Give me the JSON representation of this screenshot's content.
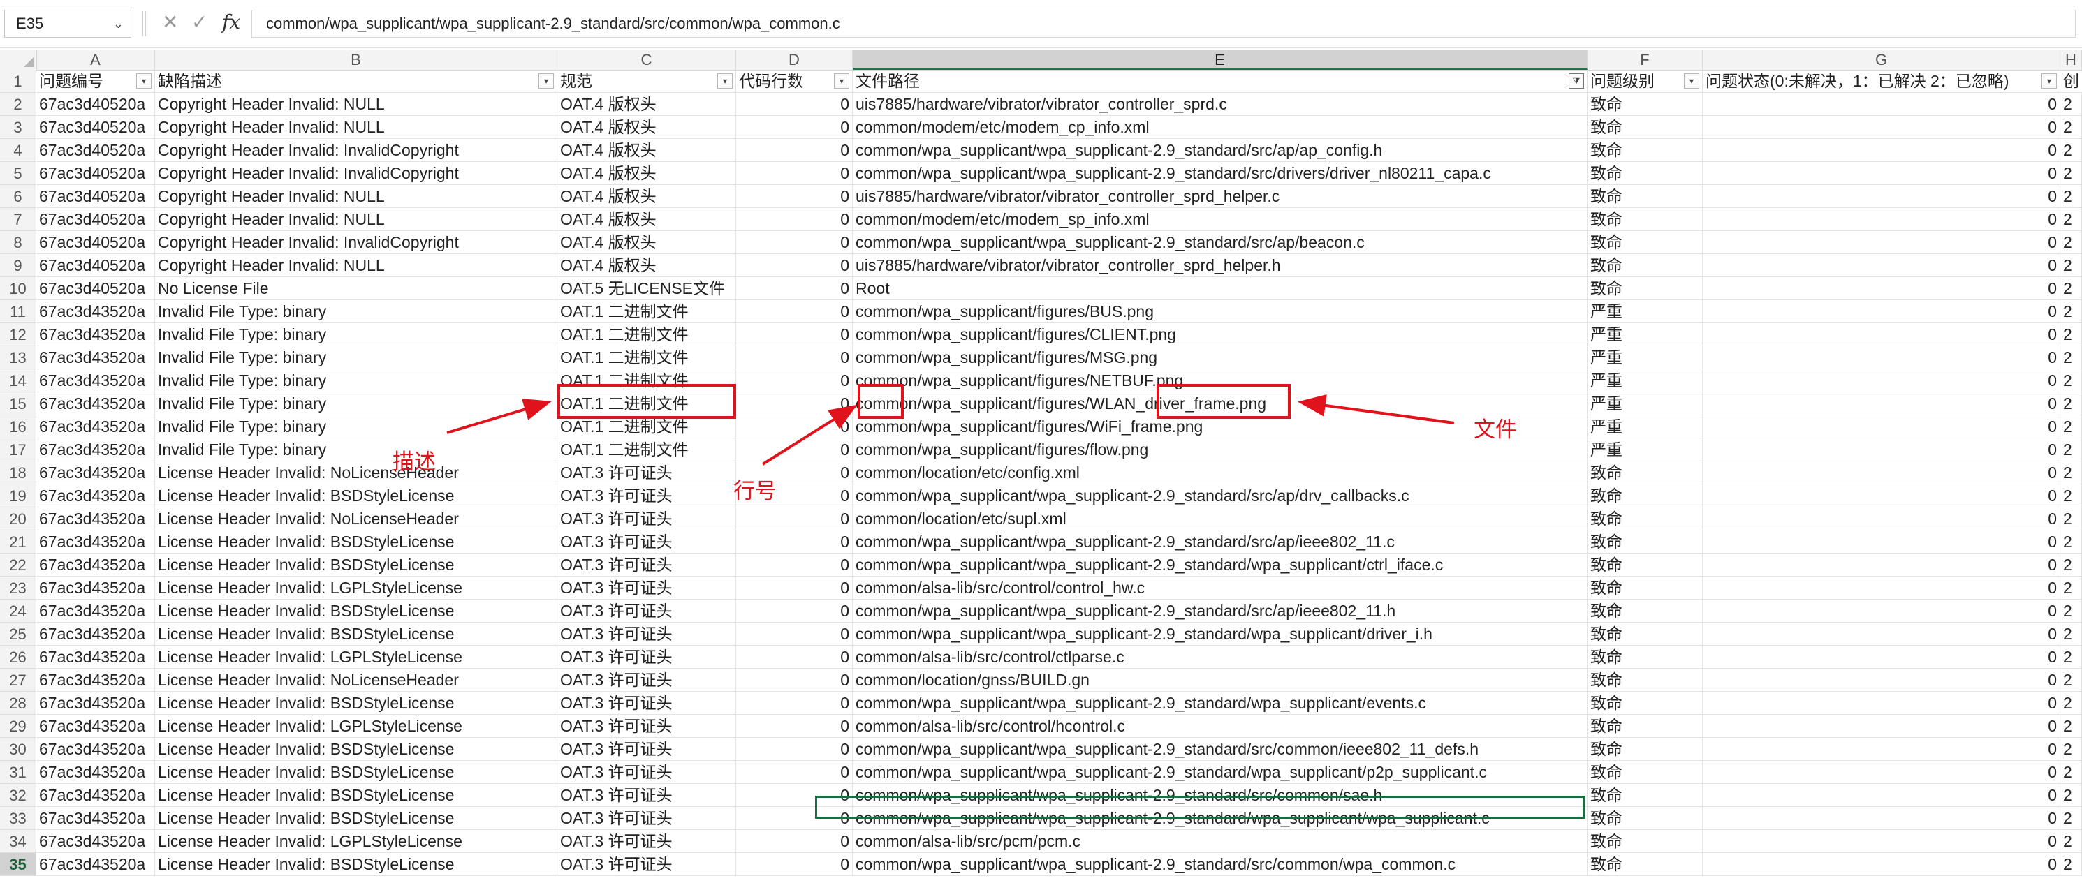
{
  "formula_bar": {
    "name_box": "E35",
    "cancel_symbol": "✕",
    "confirm_symbol": "✓",
    "fx_symbol": "fx",
    "formula": "common/wpa_supplicant/wpa_supplicant-2.9_standard/src/common/wpa_common.c"
  },
  "columns": [
    "A",
    "B",
    "C",
    "D",
    "E",
    "F",
    "G",
    "H"
  ],
  "active_column": "E",
  "header_row": {
    "row_number": "1",
    "cells": [
      "问题编号",
      "缺陷描述",
      "规范",
      "代码行数",
      "文件路径",
      "问题级别",
      "问题状态(0:未解决，1：已解决 2：已忽略)",
      "创"
    ],
    "filtered_column": "E"
  },
  "rows": [
    {
      "n": "2",
      "cells": [
        "67ac3d40520a",
        "Copyright Header Invalid: NULL",
        "OAT.4 版权头",
        "0",
        "uis7885/hardware/vibrator/vibrator_controller_sprd.c",
        "致命",
        "0",
        "2"
      ]
    },
    {
      "n": "3",
      "cells": [
        "67ac3d40520a",
        "Copyright Header Invalid: NULL",
        "OAT.4 版权头",
        "0",
        "common/modem/etc/modem_cp_info.xml",
        "致命",
        "0",
        "2"
      ]
    },
    {
      "n": "4",
      "cells": [
        "67ac3d40520a",
        "Copyright Header Invalid: InvalidCopyright",
        "OAT.4 版权头",
        "0",
        "common/wpa_supplicant/wpa_supplicant-2.9_standard/src/ap/ap_config.h",
        "致命",
        "0",
        "2"
      ]
    },
    {
      "n": "5",
      "cells": [
        "67ac3d40520a",
        "Copyright Header Invalid: InvalidCopyright",
        "OAT.4 版权头",
        "0",
        "common/wpa_supplicant/wpa_supplicant-2.9_standard/src/drivers/driver_nl80211_capa.c",
        "致命",
        "0",
        "2"
      ]
    },
    {
      "n": "6",
      "cells": [
        "67ac3d40520a",
        "Copyright Header Invalid: NULL",
        "OAT.4 版权头",
        "0",
        "uis7885/hardware/vibrator/vibrator_controller_sprd_helper.c",
        "致命",
        "0",
        "2"
      ]
    },
    {
      "n": "7",
      "cells": [
        "67ac3d40520a",
        "Copyright Header Invalid: NULL",
        "OAT.4 版权头",
        "0",
        "common/modem/etc/modem_sp_info.xml",
        "致命",
        "0",
        "2"
      ]
    },
    {
      "n": "8",
      "cells": [
        "67ac3d40520a",
        "Copyright Header Invalid: InvalidCopyright",
        "OAT.4 版权头",
        "0",
        "common/wpa_supplicant/wpa_supplicant-2.9_standard/src/ap/beacon.c",
        "致命",
        "0",
        "2"
      ]
    },
    {
      "n": "9",
      "cells": [
        "67ac3d40520a",
        "Copyright Header Invalid: NULL",
        "OAT.4 版权头",
        "0",
        "uis7885/hardware/vibrator/vibrator_controller_sprd_helper.h",
        "致命",
        "0",
        "2"
      ]
    },
    {
      "n": "10",
      "cells": [
        "67ac3d40520a",
        "No License File",
        "OAT.5 无LICENSE文件",
        "0",
        "Root",
        "致命",
        "0",
        "2"
      ]
    },
    {
      "n": "11",
      "cells": [
        "67ac3d43520a",
        "Invalid File Type: binary",
        "OAT.1 二进制文件",
        "0",
        "common/wpa_supplicant/figures/BUS.png",
        "严重",
        "0",
        "2"
      ]
    },
    {
      "n": "12",
      "cells": [
        "67ac3d43520a",
        "Invalid File Type: binary",
        "OAT.1 二进制文件",
        "0",
        "common/wpa_supplicant/figures/CLIENT.png",
        "严重",
        "0",
        "2"
      ]
    },
    {
      "n": "13",
      "cells": [
        "67ac3d43520a",
        "Invalid File Type: binary",
        "OAT.1 二进制文件",
        "0",
        "common/wpa_supplicant/figures/MSG.png",
        "严重",
        "0",
        "2"
      ]
    },
    {
      "n": "14",
      "cells": [
        "67ac3d43520a",
        "Invalid File Type: binary",
        "OAT.1 二进制文件",
        "0",
        "common/wpa_supplicant/figures/NETBUF.png",
        "严重",
        "0",
        "2"
      ]
    },
    {
      "n": "15",
      "cells": [
        "67ac3d43520a",
        "Invalid File Type: binary",
        "OAT.1 二进制文件",
        "0",
        "common/wpa_supplicant/figures/WLAN_driver_frame.png",
        "严重",
        "0",
        "2"
      ]
    },
    {
      "n": "16",
      "cells": [
        "67ac3d43520a",
        "Invalid File Type: binary",
        "OAT.1 二进制文件",
        "0",
        "common/wpa_supplicant/figures/WiFi_frame.png",
        "严重",
        "0",
        "2"
      ]
    },
    {
      "n": "17",
      "cells": [
        "67ac3d43520a",
        "Invalid File Type: binary",
        "OAT.1 二进制文件",
        "0",
        "common/wpa_supplicant/figures/flow.png",
        "严重",
        "0",
        "2"
      ]
    },
    {
      "n": "18",
      "cells": [
        "67ac3d43520a",
        "License Header Invalid: NoLicenseHeader",
        "OAT.3 许可证头",
        "0",
        "common/location/etc/config.xml",
        "致命",
        "0",
        "2"
      ]
    },
    {
      "n": "19",
      "cells": [
        "67ac3d43520a",
        "License Header Invalid: BSDStyleLicense",
        "OAT.3 许可证头",
        "0",
        "common/wpa_supplicant/wpa_supplicant-2.9_standard/src/ap/drv_callbacks.c",
        "致命",
        "0",
        "2"
      ]
    },
    {
      "n": "20",
      "cells": [
        "67ac3d43520a",
        "License Header Invalid: NoLicenseHeader",
        "OAT.3 许可证头",
        "0",
        "common/location/etc/supl.xml",
        "致命",
        "0",
        "2"
      ]
    },
    {
      "n": "21",
      "cells": [
        "67ac3d43520a",
        "License Header Invalid: BSDStyleLicense",
        "OAT.3 许可证头",
        "0",
        "common/wpa_supplicant/wpa_supplicant-2.9_standard/src/ap/ieee802_11.c",
        "致命",
        "0",
        "2"
      ]
    },
    {
      "n": "22",
      "cells": [
        "67ac3d43520a",
        "License Header Invalid: BSDStyleLicense",
        "OAT.3 许可证头",
        "0",
        "common/wpa_supplicant/wpa_supplicant-2.9_standard/wpa_supplicant/ctrl_iface.c",
        "致命",
        "0",
        "2"
      ]
    },
    {
      "n": "23",
      "cells": [
        "67ac3d43520a",
        "License Header Invalid: LGPLStyleLicense",
        "OAT.3 许可证头",
        "0",
        "common/alsa-lib/src/control/control_hw.c",
        "致命",
        "0",
        "2"
      ]
    },
    {
      "n": "24",
      "cells": [
        "67ac3d43520a",
        "License Header Invalid: BSDStyleLicense",
        "OAT.3 许可证头",
        "0",
        "common/wpa_supplicant/wpa_supplicant-2.9_standard/src/ap/ieee802_11.h",
        "致命",
        "0",
        "2"
      ]
    },
    {
      "n": "25",
      "cells": [
        "67ac3d43520a",
        "License Header Invalid: BSDStyleLicense",
        "OAT.3 许可证头",
        "0",
        "common/wpa_supplicant/wpa_supplicant-2.9_standard/wpa_supplicant/driver_i.h",
        "致命",
        "0",
        "2"
      ]
    },
    {
      "n": "26",
      "cells": [
        "67ac3d43520a",
        "License Header Invalid: LGPLStyleLicense",
        "OAT.3 许可证头",
        "0",
        "common/alsa-lib/src/control/ctlparse.c",
        "致命",
        "0",
        "2"
      ]
    },
    {
      "n": "27",
      "cells": [
        "67ac3d43520a",
        "License Header Invalid: NoLicenseHeader",
        "OAT.3 许可证头",
        "0",
        "common/location/gnss/BUILD.gn",
        "致命",
        "0",
        "2"
      ]
    },
    {
      "n": "28",
      "cells": [
        "67ac3d43520a",
        "License Header Invalid: BSDStyleLicense",
        "OAT.3 许可证头",
        "0",
        "common/wpa_supplicant/wpa_supplicant-2.9_standard/wpa_supplicant/events.c",
        "致命",
        "0",
        "2"
      ]
    },
    {
      "n": "29",
      "cells": [
        "67ac3d43520a",
        "License Header Invalid: LGPLStyleLicense",
        "OAT.3 许可证头",
        "0",
        "common/alsa-lib/src/control/hcontrol.c",
        "致命",
        "0",
        "2"
      ]
    },
    {
      "n": "30",
      "cells": [
        "67ac3d43520a",
        "License Header Invalid: BSDStyleLicense",
        "OAT.3 许可证头",
        "0",
        "common/wpa_supplicant/wpa_supplicant-2.9_standard/src/common/ieee802_11_defs.h",
        "致命",
        "0",
        "2"
      ]
    },
    {
      "n": "31",
      "cells": [
        "67ac3d43520a",
        "License Header Invalid: BSDStyleLicense",
        "OAT.3 许可证头",
        "0",
        "common/wpa_supplicant/wpa_supplicant-2.9_standard/wpa_supplicant/p2p_supplicant.c",
        "致命",
        "0",
        "2"
      ]
    },
    {
      "n": "32",
      "cells": [
        "67ac3d43520a",
        "License Header Invalid: BSDStyleLicense",
        "OAT.3 许可证头",
        "0",
        "common/wpa_supplicant/wpa_supplicant-2.9_standard/src/common/sae.h",
        "致命",
        "0",
        "2"
      ]
    },
    {
      "n": "33",
      "cells": [
        "67ac3d43520a",
        "License Header Invalid: BSDStyleLicense",
        "OAT.3 许可证头",
        "0",
        "common/wpa_supplicant/wpa_supplicant-2.9_standard/wpa_supplicant/wpa_supplicant.c",
        "致命",
        "0",
        "2"
      ]
    },
    {
      "n": "34",
      "cells": [
        "67ac3d43520a",
        "License Header Invalid: LGPLStyleLicense",
        "OAT.3 许可证头",
        "0",
        "common/alsa-lib/src/pcm/pcm.c",
        "致命",
        "0",
        "2"
      ]
    },
    {
      "n": "35",
      "cells": [
        "67ac3d43520a",
        "License Header Invalid: BSDStyleLicense",
        "OAT.3 许可证头",
        "0",
        "common/wpa_supplicant/wpa_supplicant-2.9_standard/src/common/wpa_common.c",
        "致命",
        "0",
        "2"
      ]
    }
  ],
  "annotations": {
    "color": "#e0121b",
    "description_label": "描述",
    "line_label": "行号",
    "file_label": "文件"
  },
  "colors": {
    "grid_line": "#e3e3e3",
    "header_bg": "#f3f3f3",
    "active_header_bg": "#d2d2d2",
    "excel_green": "#217346",
    "active_cell_border": "#1f6b41"
  }
}
